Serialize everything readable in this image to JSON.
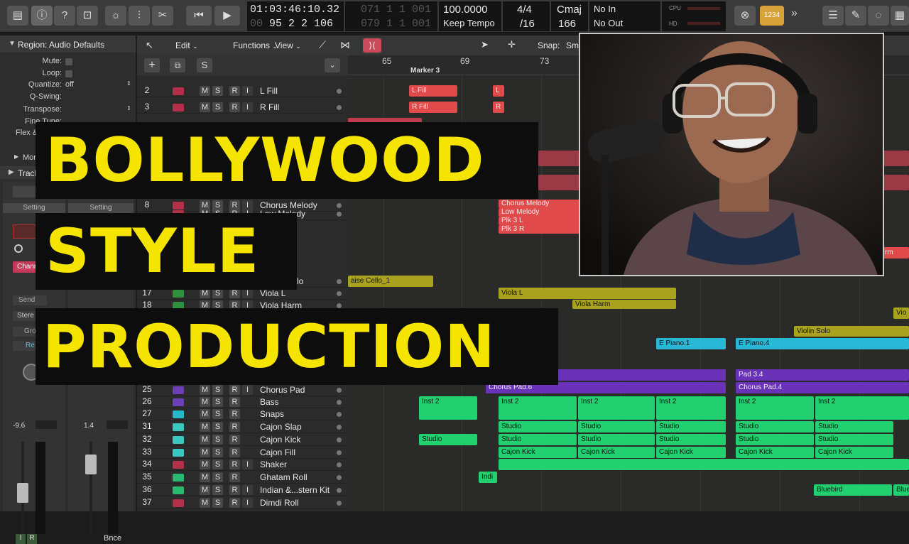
{
  "transport": {
    "time": "01:03:46:10.32",
    "time_ghost": "00",
    "bars_top": "071 1 1 001",
    "bars_bottom": "95 2 2 106",
    "bars_bottom_ghost": "079 1 1 001",
    "tempo": "100.0000",
    "tempo_mode": "Keep Tempo",
    "signature": "4/4",
    "division": "/16",
    "key": "Cmaj",
    "key_value": "166",
    "midi_in": "No In",
    "midi_out": "No Out",
    "cpu_label": "CPU",
    "hd_label": "HD",
    "count_in": "1234"
  },
  "inspector": {
    "region_title": "Region: Audio Defaults",
    "rows": [
      {
        "label": "Mute:",
        "value": ""
      },
      {
        "label": "Loop:",
        "value": ""
      },
      {
        "label": "Quantize:",
        "value": "off"
      },
      {
        "label": "Q-Swing:",
        "value": ""
      },
      {
        "label": "Transpose:",
        "value": ""
      },
      {
        "label": "Fine Tune:",
        "value": ""
      },
      {
        "label": "Flex &",
        "value": ""
      }
    ],
    "more": "Mor",
    "track": "Track",
    "setting_left": "Setting",
    "setting_right": "Setting",
    "channel_btn": "Chann",
    "send": "Send",
    "stereo": "Stere",
    "group": "Gro",
    "read": "Re",
    "vol_left": "-9.6",
    "vol_right": "1.4",
    "bottom_i": "I",
    "bottom_r": "R",
    "bounce": "Bnce"
  },
  "track_toolbar": {
    "menus": [
      "Edit",
      "Functions",
      "View"
    ],
    "snap_label": "Snap:",
    "snap_value": "Sm"
  },
  "ruler": {
    "bars": [
      "65",
      "69",
      "73"
    ],
    "marker": "Marker 3"
  },
  "tracks": [
    {
      "num": "2",
      "name": "L Fill",
      "icon_color": "#b4304a",
      "m": "M",
      "s": "S",
      "r": "R",
      "i": "I"
    },
    {
      "num": "3",
      "name": "R Fill",
      "icon_color": "#b4304a",
      "m": "M",
      "s": "S",
      "r": "R",
      "i": "I"
    },
    {
      "num": "8",
      "name": "Chorus Melody",
      "icon_color": "#b4304a",
      "m": "M",
      "s": "S",
      "r": "R",
      "i": "I"
    },
    {
      "num": "",
      "name": "Low Melody",
      "icon_color": "#b4304a",
      "m": "M",
      "s": "S",
      "r": "R",
      "i": "I"
    },
    {
      "num": "",
      "name": "Raise Cello",
      "icon_color": "#7a6a1a",
      "m": "M",
      "s": "S",
      "r": "R",
      "i": "I"
    },
    {
      "num": "17",
      "name": "Viola L",
      "icon_color": "#2e8f3c",
      "m": "M",
      "s": "S",
      "r": "R",
      "i": "I"
    },
    {
      "num": "18",
      "name": "Viola Harm",
      "icon_color": "#2e8f3c",
      "m": "M",
      "s": "S",
      "r": "R",
      "i": "I"
    },
    {
      "num": "25",
      "name": "Chorus Pad",
      "icon_color": "#6b3fb5",
      "m": "M",
      "s": "S",
      "r": "R",
      "i": "I"
    },
    {
      "num": "26",
      "name": "Bass",
      "icon_color": "#6b3fb5",
      "m": "M",
      "s": "S",
      "r": "R",
      "i": ""
    },
    {
      "num": "27",
      "name": "Snaps",
      "icon_color": "#24b8c8",
      "m": "M",
      "s": "S",
      "r": "R",
      "i": ""
    },
    {
      "num": "31",
      "name": "Cajon Slap",
      "icon_color": "#39c9c0",
      "m": "M",
      "s": "S",
      "r": "R",
      "i": ""
    },
    {
      "num": "32",
      "name": "Cajon Kick",
      "icon_color": "#39c9c0",
      "m": "M",
      "s": "S",
      "r": "R",
      "i": ""
    },
    {
      "num": "33",
      "name": "Cajon Fill",
      "icon_color": "#39c9c0",
      "m": "M",
      "s": "S",
      "r": "R",
      "i": ""
    },
    {
      "num": "34",
      "name": "Shaker",
      "icon_color": "#b4304a",
      "m": "M",
      "s": "S",
      "r": "R",
      "i": "I"
    },
    {
      "num": "35",
      "name": "Ghatam Roll",
      "icon_color": "#2ab870",
      "m": "M",
      "s": "S",
      "r": "R",
      "i": ""
    },
    {
      "num": "36",
      "name": "Indian &...stern Kit",
      "icon_color": "#2ab870",
      "m": "M",
      "s": "S",
      "r": "R",
      "i": "I"
    },
    {
      "num": "37",
      "name": "Dimdi Roll",
      "icon_color": "#b4304a",
      "m": "M",
      "s": "S",
      "r": "R",
      "i": "I"
    }
  ],
  "regions": {
    "l_fill": "L Fill",
    "r_fill": "R Fill",
    "l": "L",
    "r": "R",
    "chorus_melody": "Chorus Melody",
    "low_melody": "Low Melody",
    "plk3l": "Plk 3 L",
    "plk3r": "Plk 3 R",
    "cello": "aise Cello_1",
    "viola_l": "Viola L",
    "viola_harm": "Viola Harm",
    "vio": "Vio",
    "violin_solo": "Violin Solo",
    "e_piano_1": "E Piano.1",
    "e_piano_4": "E Piano.4",
    "pad_34": "Pad 3.4",
    "chorus_pad_6": "Chorus Pad.6",
    "chorus_pad_4": "Chorus Pad.4",
    "inst2": "Inst 2",
    "studio": "Studio",
    "cajon_kick": "Cajon Kick",
    "indi": "Indi",
    "bluebird": "Bluebird",
    "blue": "Blue",
    "rm": "rm"
  },
  "overlay": {
    "line1": "BOLLYWOOD",
    "line2": "STYLE",
    "line3": "PRODUCTION"
  },
  "colors": {
    "title_yellow": "#f5e300",
    "red_region": "#e04a4a",
    "olive_region": "#a9a21c",
    "cyan_region": "#29b7d6",
    "purple_region": "#6a32b8",
    "green_region": "#22d070"
  }
}
